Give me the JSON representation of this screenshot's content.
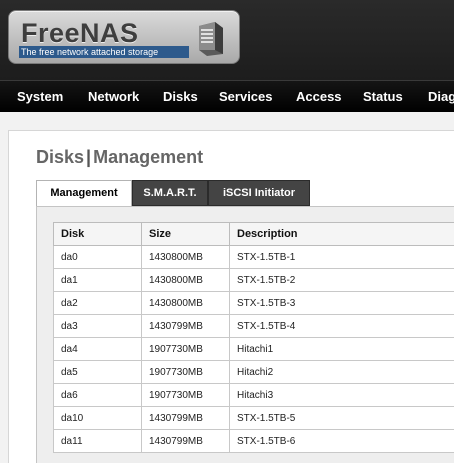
{
  "logo": {
    "title": "FreeNAS",
    "tagline": "The free network attached storage"
  },
  "nav": {
    "items": [
      {
        "label": "System",
        "name": "nav-system"
      },
      {
        "label": "Network",
        "name": "nav-network"
      },
      {
        "label": "Disks",
        "name": "nav-disks"
      },
      {
        "label": "Services",
        "name": "nav-services"
      },
      {
        "label": "Access",
        "name": "nav-access"
      },
      {
        "label": "Status",
        "name": "nav-status"
      },
      {
        "label": "Diag",
        "name": "nav-diagnostics"
      }
    ]
  },
  "page": {
    "title_section": "Disks",
    "title_separator": "|",
    "title_page": "Management"
  },
  "tabs": [
    {
      "label": "Management",
      "active": true
    },
    {
      "label": "S.M.A.R.T.",
      "active": false
    },
    {
      "label": "iSCSI Initiator",
      "active": false
    }
  ],
  "table": {
    "columns": [
      "Disk",
      "Size",
      "Description"
    ],
    "rows": [
      [
        "da0",
        "1430800MB",
        "STX-1.5TB-1"
      ],
      [
        "da1",
        "1430800MB",
        "STX-1.5TB-2"
      ],
      [
        "da2",
        "1430800MB",
        "STX-1.5TB-3"
      ],
      [
        "da3",
        "1430799MB",
        "STX-1.5TB-4"
      ],
      [
        "da4",
        "1907730MB",
        "Hitachi1"
      ],
      [
        "da5",
        "1907730MB",
        "Hitachi2"
      ],
      [
        "da6",
        "1907730MB",
        "Hitachi3"
      ],
      [
        "da10",
        "1430799MB",
        "STX-1.5TB-5"
      ],
      [
        "da11",
        "1430799MB",
        "STX-1.5TB-6"
      ]
    ]
  },
  "colors": {
    "header_bg": "#1d1d1d",
    "nav_bg": "#000000",
    "tagline_bg": "#2d5a8c",
    "inactive_tab_bg": "#444444"
  }
}
